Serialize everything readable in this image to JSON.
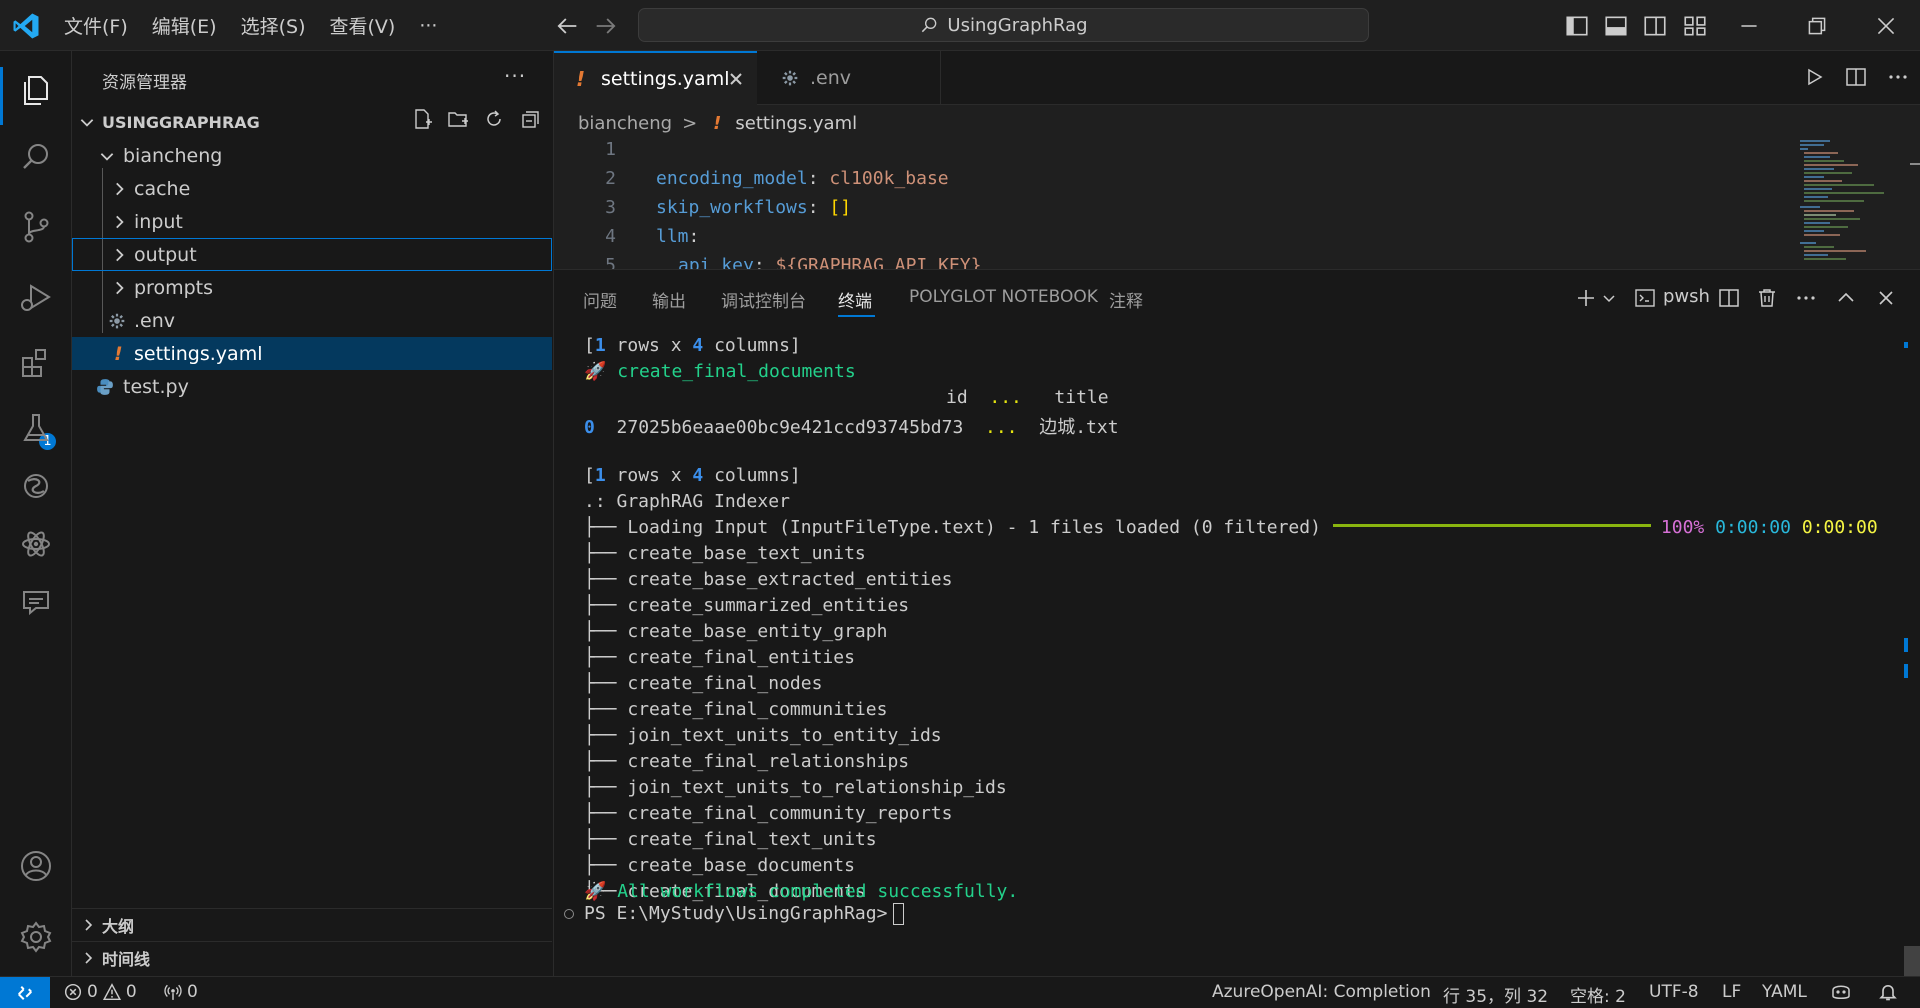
{
  "titlebar": {
    "menu": [
      "文件(F)",
      "编辑(E)",
      "选择(S)",
      "查看(V)",
      "···"
    ],
    "search_text": "UsingGraphRag"
  },
  "activity": {
    "extensions_badge": "1"
  },
  "sidebar": {
    "title": "资源管理器",
    "more": "···",
    "workspace": "USINGGRAPHRAG",
    "tree": {
      "biancheng": "biancheng",
      "cache": "cache",
      "input": "input",
      "output": "output",
      "prompts": "prompts",
      "env": ".env",
      "settings": "settings.yaml",
      "test": "test.py"
    },
    "outline": "大纲",
    "timeline": "时间线"
  },
  "editor": {
    "tabs": [
      {
        "label": "settings.yaml",
        "icon": "!"
      },
      {
        "label": ".env"
      }
    ],
    "breadcrumb": {
      "folder": "biancheng",
      "sep": ">",
      "file_icon": "!",
      "file": "settings.yaml"
    },
    "lines": [
      {
        "num": "1"
      },
      {
        "num": "2",
        "key": "encoding_model",
        "value": "cl100k_base"
      },
      {
        "num": "3",
        "key": "skip_workflows",
        "value": "[]"
      },
      {
        "num": "4",
        "key": "llm"
      },
      {
        "num": "5",
        "key": "api_key",
        "value": "${GRAPHRAG_API_KEY}"
      }
    ]
  },
  "panel": {
    "tabs": [
      "问题",
      "输出",
      "调试控制台",
      "终端",
      "POLYGLOT NOTEBOOK",
      "注释"
    ],
    "shell": "pwsh"
  },
  "terminal": {
    "rows_cols_1": {
      "open": "[",
      "n1": "1",
      "mid": " rows x ",
      "n2": "4",
      "end": " columns]"
    },
    "header_workflow": "create_final_documents",
    "table_header": {
      "id": "id",
      "dots": "...",
      "title": "title"
    },
    "table_row": {
      "idx": "0",
      "id": "27025b6eaae00bc9e421ccd93745bd73",
      "dots": "...",
      "title": "边城.txt"
    },
    "rows_cols_2": {
      "open": "[",
      "n1": "1",
      "mid": " rows x ",
      "n2": "4",
      "end": " columns]"
    },
    "indexer_title": ".: GraphRAG Indexer",
    "loading": "Loading Input (InputFileType.text) - 1 files loaded (0 filtered)",
    "loading_progress": 1.0,
    "loading_percent": "100%",
    "loading_elapsed": "0:00:00",
    "loading_remaining": "0:00:00",
    "workflows": [
      "create_base_text_units",
      "create_base_extracted_entities",
      "create_summarized_entities",
      "create_base_entity_graph",
      "create_final_entities",
      "create_final_nodes",
      "create_final_communities",
      "join_text_units_to_entity_ids",
      "create_final_relationships",
      "join_text_units_to_relationship_ids",
      "create_final_community_reports",
      "create_final_text_units",
      "create_base_documents",
      "create_final_documents"
    ],
    "done": "All workflows completed successfully.",
    "prompt": "PS E:\\MyStudy\\UsingGraphRag>"
  },
  "statusbar": {
    "errors": "0",
    "warnings": "0",
    "ports": "0",
    "azure": "AzureOpenAI: Completion",
    "position": "行 35，列 32",
    "spaces": "空格: 2",
    "encoding": "UTF-8",
    "eol": "LF",
    "language": "YAML"
  },
  "colors": {
    "accent": "#0078d4",
    "yaml_icon": "#e37933",
    "progress": "#8ab50f"
  }
}
